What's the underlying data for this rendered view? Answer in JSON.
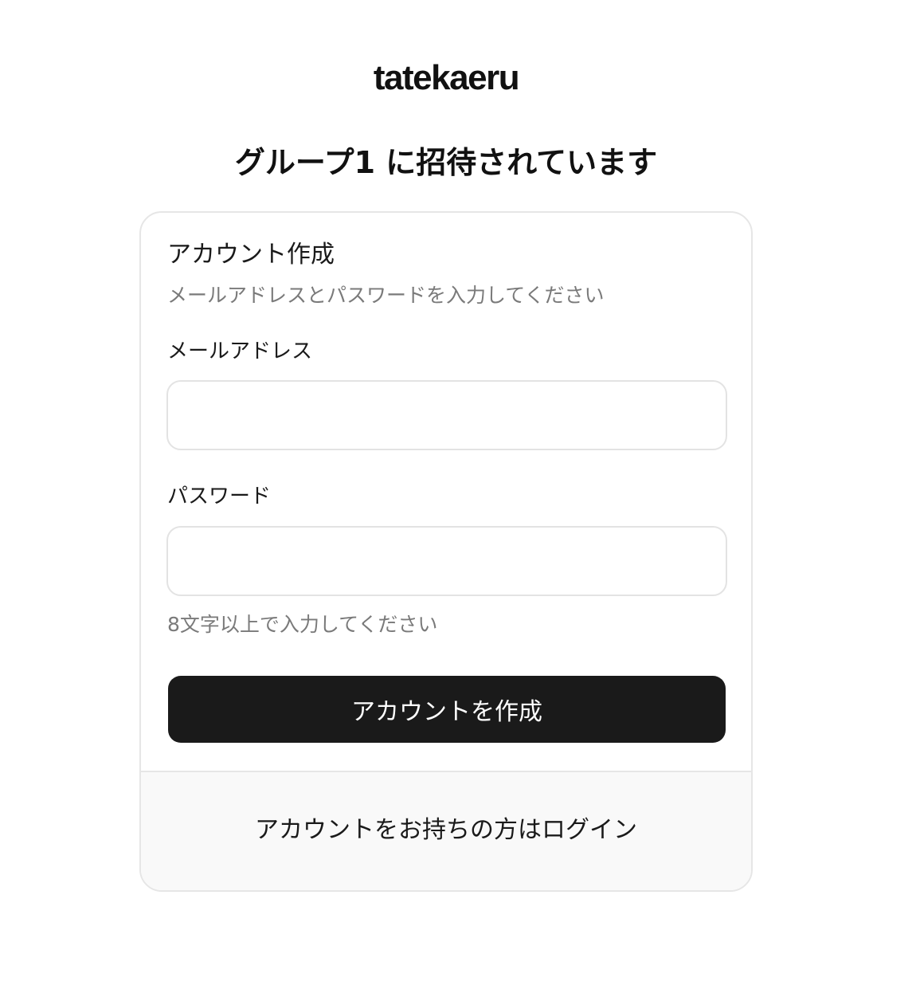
{
  "brand": {
    "logo_text": "tatekaeru"
  },
  "invite": {
    "title": "グループ1 に招待されています"
  },
  "form": {
    "title": "アカウント作成",
    "description": "メールアドレスとパスワードを入力してください",
    "email": {
      "label": "メールアドレス",
      "value": "",
      "placeholder": ""
    },
    "password": {
      "label": "パスワード",
      "value": "",
      "placeholder": "",
      "hint": "8文字以上で入力してください"
    },
    "submit_label": "アカウントを作成"
  },
  "footer": {
    "login_link": "アカウントをお持ちの方はログイン"
  },
  "colors": {
    "primary_button": "#1a1a1a",
    "muted_text": "#7a7a7a",
    "border": "#e6e6e6",
    "footer_bg": "#f9f9f9"
  }
}
